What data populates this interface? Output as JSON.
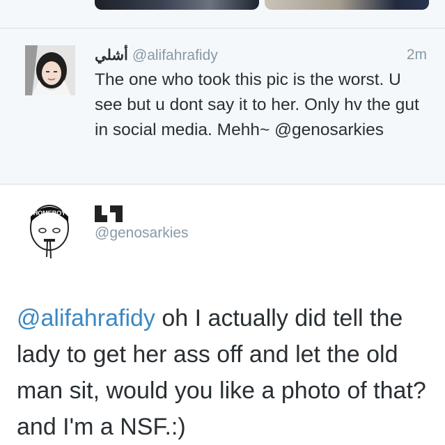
{
  "top_media": {
    "items": [
      "photo",
      "photo"
    ]
  },
  "tweet": {
    "display_name": "أشلي",
    "handle": "@alifahrafidy",
    "time": "2m",
    "text": "The one who took this pic is the worst. U see but u dont say it to her. Only hv the gut in social media. Mehh~ ",
    "mention": "@genosarkies",
    "avatar_icon": "profile-photo"
  },
  "reply": {
    "display_name_glyph": "quote-mark",
    "handle": "@genosarkies",
    "avatar_icon": "homeboy-avatar",
    "avatar_text": "HOMEBOY",
    "mention": "@alifahrafidy",
    "text": " oh I actually did tell the lady to get her ass off and let the old man sit, would you like a photo of that? and I'm a NSF.:)"
  },
  "colors": {
    "background_gray": "#f5f8fa",
    "text": "#292f33",
    "muted": "#8899a6",
    "link": "#3b88c3",
    "divider": "#d8dde2"
  }
}
